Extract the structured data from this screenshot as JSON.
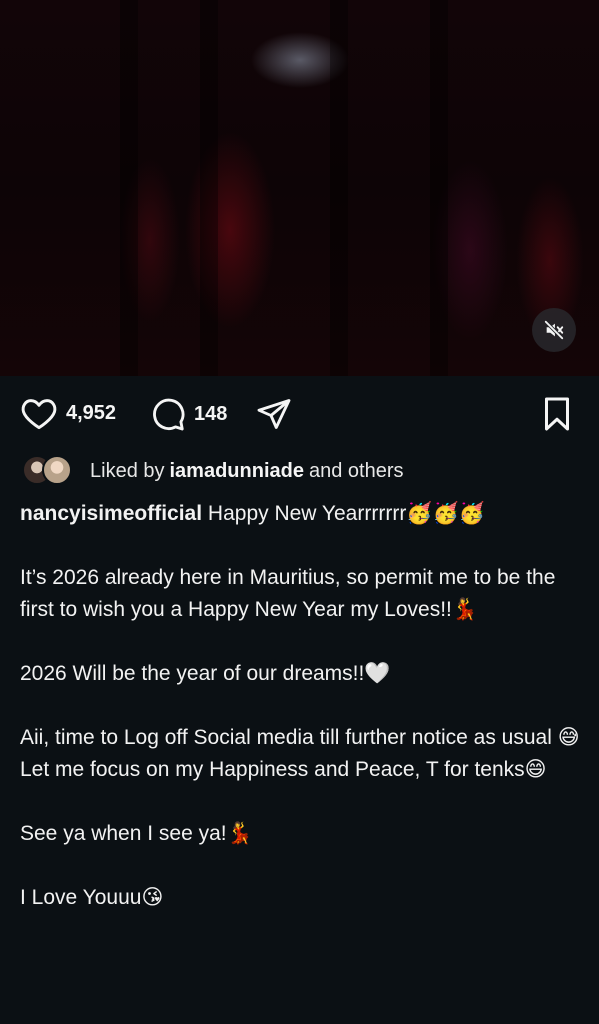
{
  "post": {
    "likes": "4,952",
    "comments": "148",
    "liked_by_prefix": "Liked by",
    "liked_by_user": "iamadunniade",
    "liked_by_suffix": "and others",
    "username": "nancyisimeofficial",
    "caption_first_line": "Happy New Yearrrrrrr🥳🥳🥳",
    "caption_paragraphs": [
      "It’s 2026 already here in Mauritius, so permit me to be the first to wish you a Happy New Year my Loves!!💃",
      "2026 Will be the year of our dreams!!🤍",
      "Aii, time to Log off Social media till further notice as usual 😅",
      "Let me focus on my Happiness and Peace, T for tenks😄",
      "See ya when I see ya!💃",
      "I Love Youuu😘"
    ]
  },
  "icons": {
    "mute": "speaker-muted-icon",
    "like": "heart-icon",
    "comment": "comment-bubble-icon",
    "share": "paper-plane-icon",
    "save": "bookmark-icon"
  },
  "colors": {
    "background": "#0b1014",
    "text": "#f5f5f5"
  }
}
